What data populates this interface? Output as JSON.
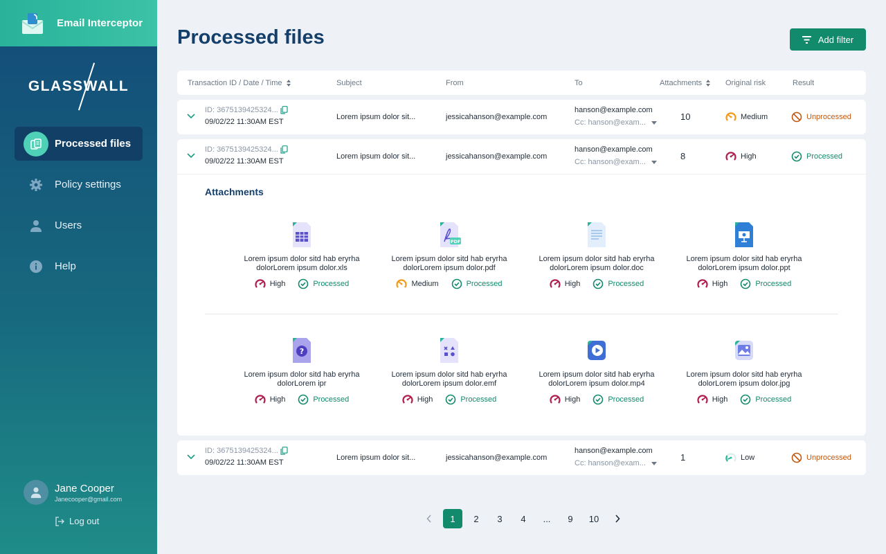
{
  "app": {
    "title": "Email Interceptor",
    "brand": "GLASSWALL"
  },
  "nav": [
    {
      "label": "Processed files",
      "icon": "files-icon",
      "active": true
    },
    {
      "label": "Policy settings",
      "icon": "gear-icon"
    },
    {
      "label": "Users",
      "icon": "user-icon"
    },
    {
      "label": "Help",
      "icon": "info-icon"
    }
  ],
  "user": {
    "name": "Jane Cooper",
    "email": "Janecooper@gmail.com",
    "logout": "Log out"
  },
  "page": {
    "title": "Processed files",
    "add_filter": "Add filter"
  },
  "columns": {
    "transaction": "Transaction ID / Date / Time",
    "subject": "Subject",
    "from": "From",
    "to": "To",
    "attachments": "Attachments",
    "risk": "Original risk",
    "result": "Result"
  },
  "rows": [
    {
      "id": "ID: 3675139425324...",
      "date": "09/02/22 11:30AM EST",
      "subject": "Lorem ipsum dolor sit...",
      "from": "jessicahanson@example.com",
      "to": "hanson@example.com",
      "cc": "Cc: hanson@exam...",
      "attachments": "10",
      "risk": "Medium",
      "result": "Unprocessed"
    },
    {
      "id": "ID: 3675139425324...",
      "date": "09/02/22 11:30AM EST",
      "subject": "Lorem ipsum dolor sit...",
      "from": "jessicahanson@example.com",
      "to": "hanson@example.com",
      "cc": "Cc: hanson@exam...",
      "attachments": "8",
      "risk": "High",
      "result": "Processed"
    },
    {
      "id": "ID: 3675139425324...",
      "date": "09/02/22 11:30AM EST",
      "subject": "Lorem ipsum dolor sit...",
      "from": "jessicahanson@example.com",
      "to": "hanson@example.com",
      "cc": "Cc: hanson@exam...",
      "attachments": "1",
      "risk": "Low",
      "result": "Unprocessed"
    }
  ],
  "attachments_panel": {
    "title": "Attachments",
    "items": [
      {
        "line1": "Lorem ipsum dolor sitd hab eryrha",
        "line2": "dolorLorem ipsum dolor.xls",
        "risk": "High",
        "result": "Processed",
        "icon": "spreadsheet-file-icon"
      },
      {
        "line1": "Lorem ipsum dolor sitd hab eryrha",
        "line2": "dolorLorem ipsum dolor.pdf",
        "risk": "Medium",
        "result": "Processed",
        "icon": "pdf-file-icon",
        "badge": "PDF"
      },
      {
        "line1": "Lorem ipsum dolor sitd hab eryrha",
        "line2": "dolorLorem ipsum dolor.doc",
        "risk": "High",
        "result": "Processed",
        "icon": "document-file-icon"
      },
      {
        "line1": "Lorem ipsum dolor sitd hab eryrha",
        "line2": "dolorLorem ipsum dolor.ppt",
        "risk": "High",
        "result": "Processed",
        "icon": "presentation-file-icon"
      },
      {
        "line1": "Lorem ipsum dolor sitd hab eryrha",
        "line2": "dolorLorem ipr",
        "risk": "High",
        "result": "Processed",
        "icon": "unknown-file-icon"
      },
      {
        "line1": "Lorem ipsum dolor sitd hab eryrha",
        "line2": "dolorLorem ipsum dolor.emf",
        "risk": "High",
        "result": "Processed",
        "icon": "shapes-file-icon"
      },
      {
        "line1": "Lorem ipsum dolor sitd hab eryrha",
        "line2": "dolorLorem ipsum dolor.mp4",
        "risk": "High",
        "result": "Processed",
        "icon": "video-file-icon"
      },
      {
        "line1": "Lorem ipsum dolor sitd hab eryrha",
        "line2": "dolorLorem ipsum dolor.jpg",
        "risk": "High",
        "result": "Processed",
        "icon": "image-file-icon"
      }
    ]
  },
  "pagination": {
    "pages": [
      "1",
      "2",
      "3",
      "4",
      "...",
      "9",
      "10"
    ],
    "active": "1"
  },
  "colors": {
    "accent": "#128a6c",
    "title": "#143f6b",
    "high": "#b01f4e",
    "medium": "#f29a1a",
    "low": "#2bb59a",
    "unprocessed": "#c2570c"
  }
}
